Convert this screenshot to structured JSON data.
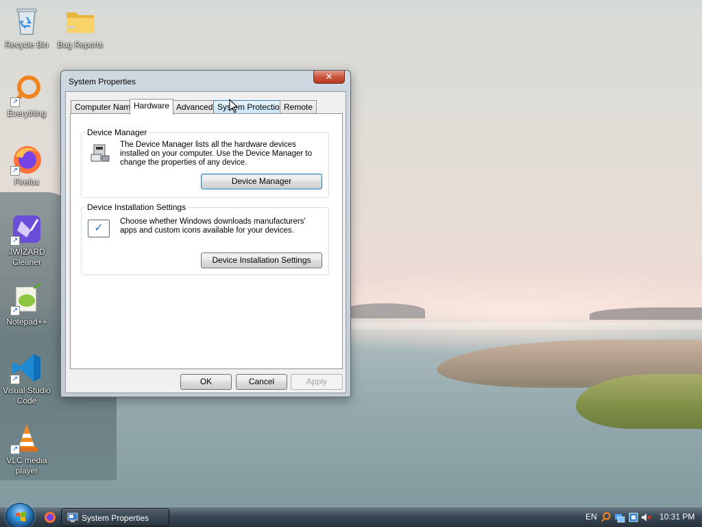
{
  "desktop": {
    "icons": [
      {
        "label": "Recycle Bin"
      },
      {
        "label": "Bug Reports"
      },
      {
        "label": "Everything"
      },
      {
        "label": "Firefox"
      },
      {
        "label": "JWIZARD Cleaner"
      },
      {
        "label": "Notepad++"
      },
      {
        "label": "Visual Studio Code"
      },
      {
        "label": "VLC media player"
      }
    ]
  },
  "dialog": {
    "title": "System Properties",
    "close_glyph": "✕",
    "tabs": [
      {
        "label": "Computer Name",
        "active": false
      },
      {
        "label": "Hardware",
        "active": true
      },
      {
        "label": "Advanced",
        "active": false
      },
      {
        "label": "System Protection",
        "active": false
      },
      {
        "label": "Remote",
        "active": false
      }
    ],
    "device_manager": {
      "legend": "Device Manager",
      "description": "The Device Manager lists all the hardware devices installed on your computer. Use the Device Manager to change the properties of any device.",
      "button": "Device Manager"
    },
    "device_installation": {
      "legend": "Device Installation Settings",
      "description": "Choose whether Windows downloads manufacturers' apps and custom icons available for your devices.",
      "button": "Device Installation Settings"
    },
    "footer": {
      "ok": "OK",
      "cancel": "Cancel",
      "apply": "Apply"
    }
  },
  "taskbar": {
    "task_label": "System Properties",
    "language": "EN",
    "clock": "10:31 PM"
  }
}
